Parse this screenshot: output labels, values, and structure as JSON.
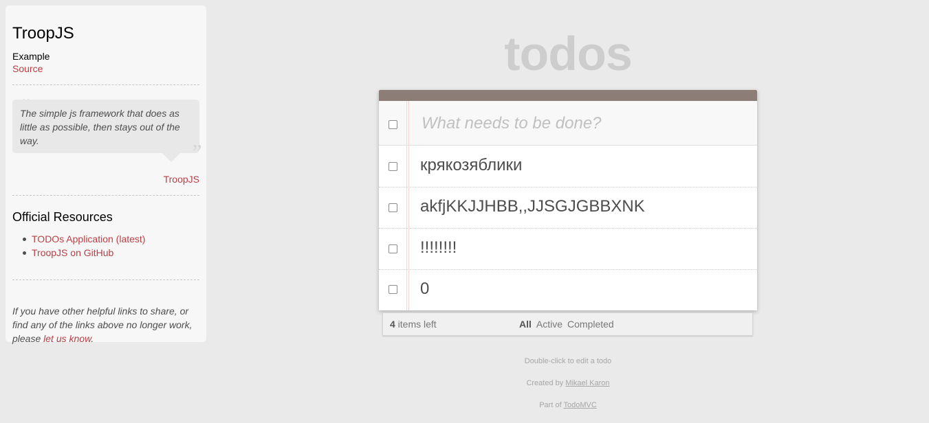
{
  "sidebar": {
    "title": "TroopJS",
    "example_label": "Example",
    "source_link": "Source",
    "quote": {
      "text": "The simple js framework that does as little as possible, then stays out of the way.",
      "author": "TroopJS"
    },
    "resources_title": "Official Resources",
    "resources": [
      {
        "label": "TODOs Application (latest)"
      },
      {
        "label": "TroopJS on GitHub"
      }
    ],
    "footer": {
      "text_before": "If you have other helpful links to share, or find any of the links above no longer work, please ",
      "link": "let us know",
      "text_after": "."
    }
  },
  "app": {
    "title": "todos",
    "new_todo_placeholder": "What needs to be done?",
    "todos": [
      {
        "title": "крякозяблики",
        "completed": false
      },
      {
        "title": "akfjKKJJHBB,,JJSGJGBBXNK",
        "completed": false
      },
      {
        "title": "!!!!!!!!",
        "completed": false
      },
      {
        "title": "0",
        "completed": false
      }
    ],
    "footer": {
      "count": "4",
      "count_suffix": " items left",
      "filters": [
        {
          "label": "All",
          "selected": true
        },
        {
          "label": "Active",
          "selected": false
        },
        {
          "label": "Completed",
          "selected": false
        }
      ]
    }
  },
  "info": {
    "hint": "Double-click to edit a todo",
    "created_by_prefix": "Created by ",
    "author": "Mikael Karon",
    "part_of_prefix": "Part of ",
    "part_of_link": "TodoMVC"
  },
  "colors": {
    "accent": "#b83f45",
    "topbar": "#8d7d77",
    "background": "#eaeaea"
  }
}
